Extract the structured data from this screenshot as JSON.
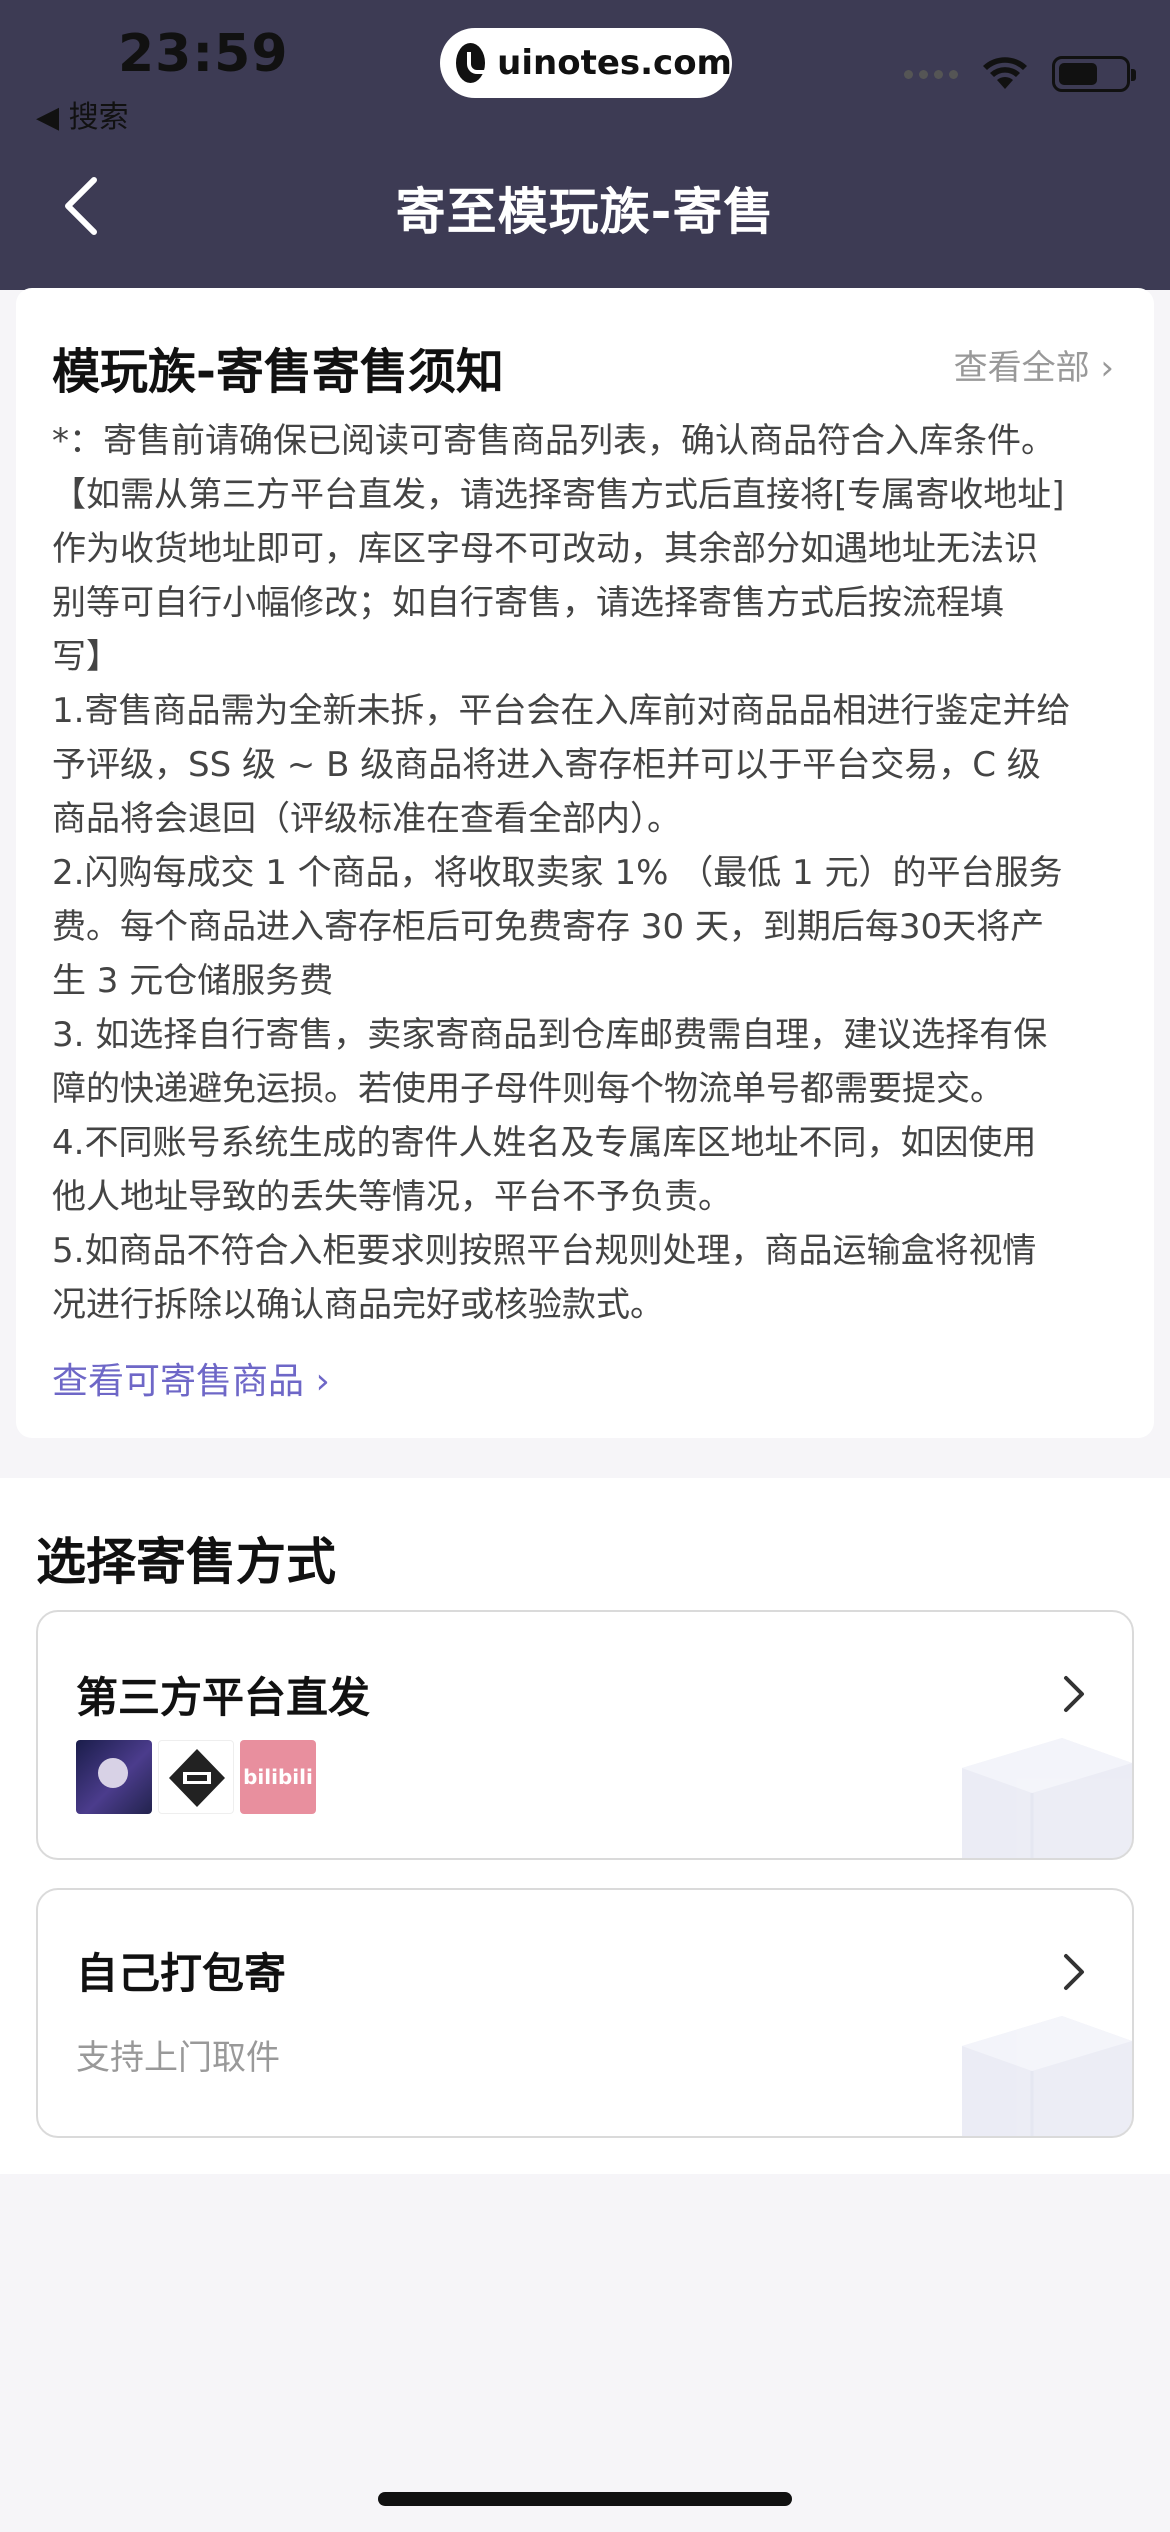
{
  "status_bar": {
    "time": "23:59",
    "back_app": "◀ 搜索",
    "watermark": "uinotes.com"
  },
  "nav": {
    "title": "寄至模玩族-寄售"
  },
  "notice": {
    "title": "模玩族-寄售寄售须知",
    "view_all": "查看全部 ›",
    "lines": [
      "*：寄售前请确保已阅读可寄售商品列表，确认商品符合入库条件。",
      "【如需从第三方平台直发，请选择寄售方式后直接将[专属寄收地址]",
      "作为收货地址即可，库区字母不可改动，其余部分如遇地址无法识",
      "别等可自行小幅修改；如自行寄售，请选择寄售方式后按流程填",
      "写】",
      "1.寄售商品需为全新未拆，平台会在入库前对商品品相进行鉴定并给",
      "予评级，SS 级 ~ B 级商品将进入寄存柜并可以于平台交易，C 级",
      "商品将会退回（评级标准在查看全部内）。",
      "2.闪购每成交 1 个商品，将收取卖家 1% （最低 1 元）的平台服务",
      "费。每个商品进入寄存柜后可免费寄存 30 天，到期后每30天将产",
      "生 3 元仓储服务费",
      "3. 如选择自行寄售，卖家寄商品到仓库邮费需自理，建议选择有保",
      "障的快递避免运损。若使用子母件则每个物流单号都需要提交。",
      "4.不同账号系统生成的寄件人姓名及专属库区地址不同，如因使用",
      "他人地址导致的丢失等情况，平台不予负责。",
      "5.如商品不符合入柜要求则按照平台规则处理，商品运输盒将视情",
      "况进行拆除以确认商品完好或核验款式。"
    ],
    "view_goods": "查看可寄售商品 ›"
  },
  "method": {
    "title": "选择寄售方式",
    "options": [
      {
        "title": "第三方平台直发",
        "logo_c_text": "bilibili"
      },
      {
        "title": "自己打包寄",
        "subtitle": "支持上门取件"
      }
    ]
  },
  "colors": {
    "header_bg": "#3d3b54",
    "link": "#6e67c7"
  }
}
